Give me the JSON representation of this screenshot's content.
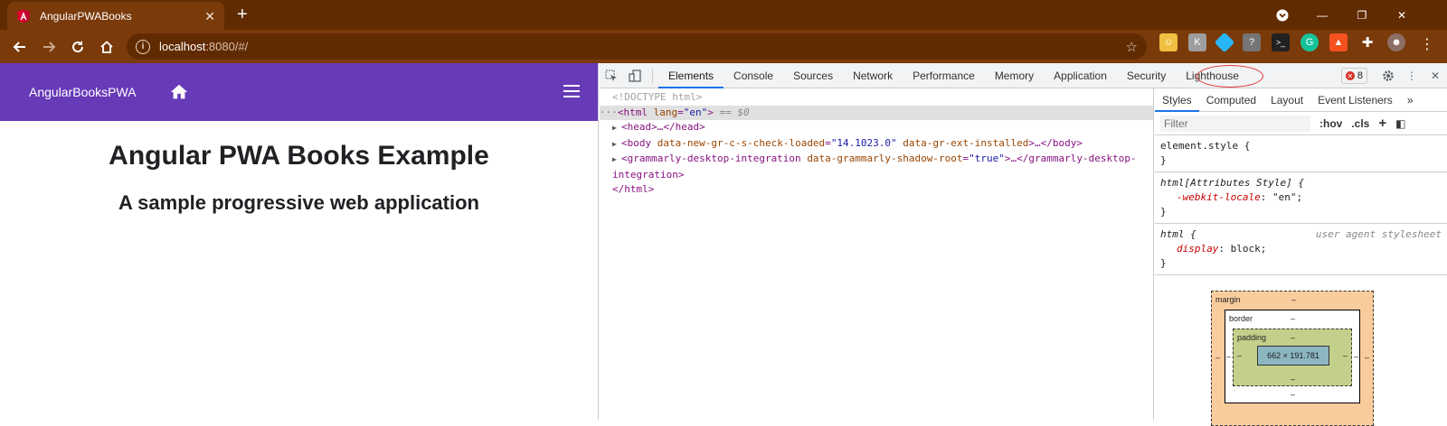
{
  "browser": {
    "tab_title": "AngularPWABooks",
    "tab_close": "✕",
    "new_tab": "+",
    "url_host": "localhost",
    "url_path": ":8080/#/",
    "controls": {
      "minimize": "—",
      "restore": "❐",
      "close": "✕"
    },
    "extensions": [
      "avatar",
      "K",
      "◆",
      "?",
      ">_",
      "G",
      "rocket",
      "puzzle",
      "profile"
    ]
  },
  "app": {
    "brand": "AngularBooksPWA",
    "heading": "Angular PWA Books Example",
    "subheading": "A sample progressive web application",
    "brand_color": "#673ab7"
  },
  "devtools": {
    "tabs": [
      "Elements",
      "Console",
      "Sources",
      "Network",
      "Performance",
      "Memory",
      "Application",
      "Security",
      "Lighthouse"
    ],
    "active_tab": "Elements",
    "highlighted_tab": "Lighthouse",
    "error_count": "8",
    "dom": {
      "doctype": "<!DOCTYPE html>",
      "html_open": "<html",
      "html_attr": "lang",
      "html_val": "\"en\"",
      "html_close": ">",
      "selected_suffix": " == $0",
      "head": "<head>…</head>",
      "body_open": "<body",
      "body_attr1": "data-new-gr-c-s-check-loaded",
      "body_val1": "\"14.1023.0\"",
      "body_attr2": "data-gr-ext-installed",
      "body_rest": ">…</body>",
      "gram_open": "<grammarly-desktop-integration",
      "gram_attr": "data-grammarly-shadow-root",
      "gram_val": "\"true\"",
      "gram_rest": ">…</grammarly-desktop-",
      "gram_cont": "integration>",
      "html_end": "</html>"
    },
    "styles": {
      "tabs": [
        "Styles",
        "Computed",
        "Layout",
        "Event Listeners"
      ],
      "filter_placeholder": "Filter",
      "hov": ":hov",
      "cls": ".cls",
      "rule1_selector": "element.style {",
      "close_brace": "}",
      "rule2_selector": "html[Attributes Style] {",
      "rule2_prop": "-webkit-locale",
      "rule2_val": "\"en\";",
      "rule3_selector": "html {",
      "rule3_origin": "user agent stylesheet",
      "rule3_prop": "display",
      "rule3_val": "block;"
    },
    "box_model": {
      "margin_label": "margin",
      "border_label": "border",
      "padding_label": "padding",
      "content_size": "662 × 191.781",
      "dash": "–"
    }
  }
}
